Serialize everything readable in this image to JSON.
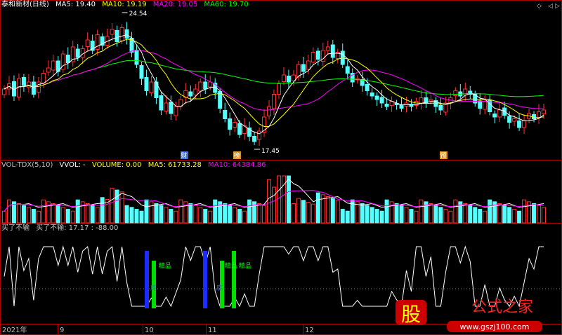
{
  "header": {
    "title": "泰和新材(日线)",
    "ma5": "MA5: 19.40",
    "ma10": "MA10: 19.19",
    "ma20": "MA20: 19.05",
    "ma60": "MA60: 19.70"
  },
  "vol_header": {
    "name": "VOL-TDX(5,10)",
    "vvol": "VVOL: -",
    "volume": "VOLUME: 0.00",
    "ma5": "MA5: 61733.28",
    "ma10": "MA10: 64384.86"
  },
  "ind_header": {
    "name": "买了不输",
    "line": "买了不输: 17.17",
    "val": ": -88.00"
  },
  "annotations": {
    "high": "24.54",
    "low": "17.45",
    "tag1": "财",
    "tag2": "榜",
    "tag3": "预",
    "sig1": "精品",
    "sig2": "精品",
    "sig3": "精品",
    "sig4": "底",
    "sig5": "底"
  },
  "xaxis": [
    "2021年",
    "9",
    "10",
    "11",
    "12"
  ],
  "watermark": {
    "char": "股",
    "text1": "公式之家",
    "text2": "www.gszj100.com"
  },
  "colors": {
    "up": "#ff3232",
    "down": "#54ffff",
    "ma5": "#ffffff",
    "ma10": "#ffff00",
    "ma20": "#ff00ff",
    "ma60": "#00ff00",
    "frame": "#b00000"
  },
  "chart_data": {
    "type": "candlestick",
    "price_range": [
      17.45,
      24.54
    ],
    "closes": [
      20.6,
      20.9,
      20.2,
      21.2,
      20.8,
      21.0,
      20.3,
      21.0,
      21.5,
      21.8,
      22.2,
      21.6,
      22.6,
      22.1,
      23.0,
      22.4,
      22.9,
      23.4,
      22.8,
      23.7,
      23.1,
      23.6,
      24.0,
      23.3,
      24.1,
      23.5,
      22.7,
      22.0,
      21.2,
      20.5,
      21.0,
      20.1,
      19.4,
      19.8,
      19.2,
      19.6,
      20.0,
      20.5,
      20.2,
      20.6,
      21.0,
      20.6,
      21.0,
      20.4,
      19.5,
      18.9,
      18.3,
      18.7,
      18.0,
      18.5,
      17.9,
      17.6,
      18.2,
      19.0,
      19.6,
      20.3,
      20.9,
      21.4,
      21.0,
      21.4,
      22.0,
      21.6,
      22.2,
      22.7,
      22.3,
      22.8,
      23.0,
      22.4,
      22.7,
      22.0,
      21.5,
      21.0,
      21.2,
      20.8,
      20.5,
      20.2,
      20.0,
      19.8,
      19.6,
      19.9,
      19.7,
      19.5,
      19.8,
      19.6,
      19.9,
      20.1,
      19.8,
      20.0,
      19.6,
      19.4,
      19.8,
      20.1,
      20.5,
      20.2,
      20.6,
      20.3,
      19.8,
      19.5,
      19.9,
      19.3,
      19.0,
      19.4,
      19.1,
      18.7,
      18.9,
      18.4,
      18.8,
      19.2,
      18.9,
      19.3,
      19.4
    ]
  }
}
